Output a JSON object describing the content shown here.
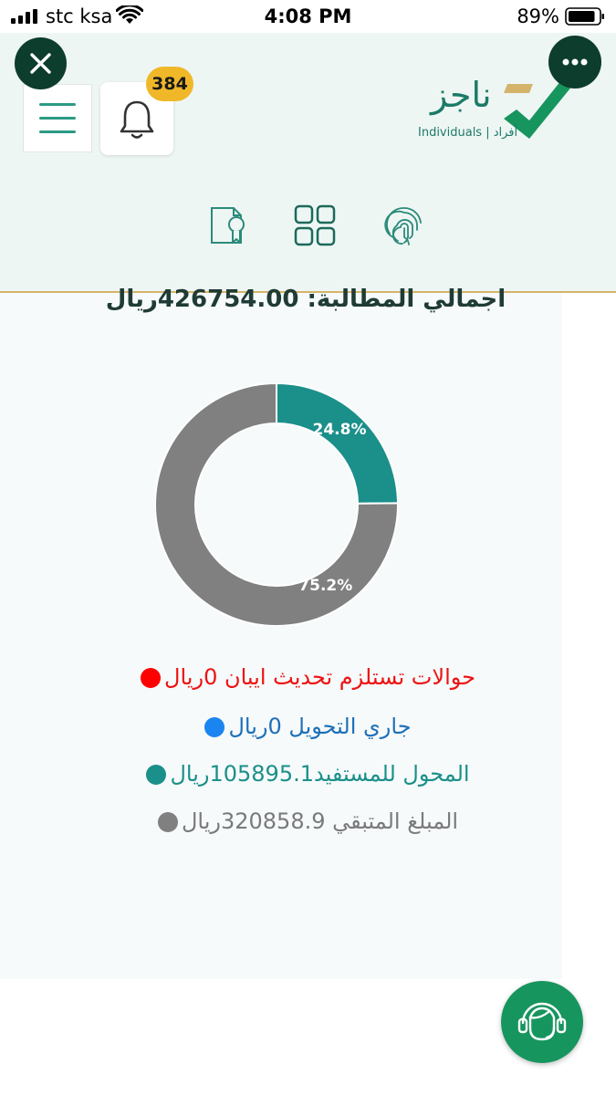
{
  "status_bar": {
    "carrier": "stc ksa",
    "time": "4:08 PM",
    "battery_percent": "89%",
    "battery_level": 0.89
  },
  "header": {
    "logo_text": "ناجز",
    "logo_subtitle": "Individuals | أفراد",
    "notification_count": "384",
    "icons": [
      "close-icon",
      "more-icon",
      "menu-icon",
      "bell-icon",
      "certificate-icon",
      "grid-icon",
      "fingerprint-icon"
    ]
  },
  "summary": {
    "total_claim": "اجمالي المطالبة: 426754.00ريال"
  },
  "chart_data": {
    "type": "pie",
    "categories": [
      "المحول للمستفيد",
      "المبلغ المتبقي"
    ],
    "values": [
      24.8,
      75.2
    ],
    "labels": [
      "24.8%",
      "75.2%"
    ],
    "colors": [
      "#1b8f8a",
      "#808080"
    ]
  },
  "legend": [
    {
      "text": "حوالات تستلزم تحديث ايبان 0ريال",
      "color": "#ee1111",
      "dot": "#ff0000"
    },
    {
      "text": "جاري التحويل 0ريال",
      "color": "#1e6fb8",
      "dot": "#1a85f0"
    },
    {
      "text": "المحول للمستفيد105895.1ريال",
      "color": "#1b8f8a",
      "dot": "#1b8f8a"
    },
    {
      "text": "المبلغ المتبقي 320858.9ريال",
      "color": "#7a7a7a",
      "dot": "#808080"
    }
  ],
  "colors": {
    "brand_dark": "#0d3d2c",
    "brand_green": "#17955e",
    "teal": "#1b8f8a",
    "accent_gold": "#d4b46a"
  }
}
